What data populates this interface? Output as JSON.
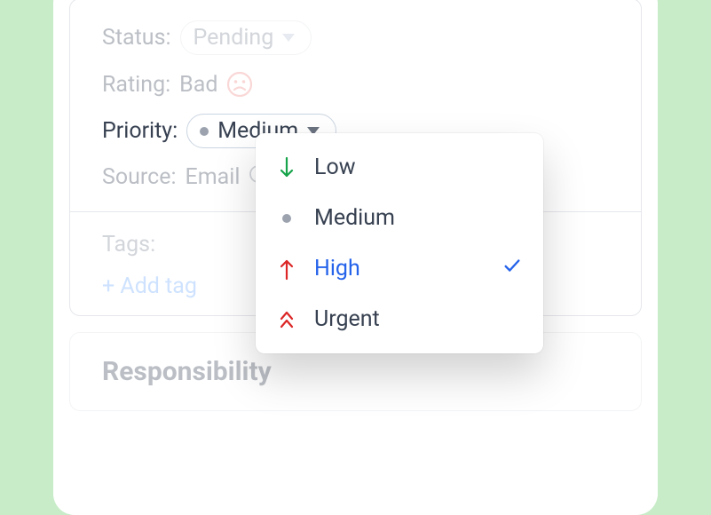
{
  "fields": {
    "status": {
      "label": "Status:",
      "value": "Pending"
    },
    "rating": {
      "label": "Rating:",
      "value": "Bad"
    },
    "priority": {
      "label": "Priority:",
      "value": "Medium"
    },
    "source": {
      "label": "Source:",
      "value": "Email"
    }
  },
  "tags": {
    "label": "Tags:",
    "add_link": "+ Add tag"
  },
  "section": {
    "heading": "Responsibility"
  },
  "priority_menu": {
    "options": [
      {
        "label": "Low"
      },
      {
        "label": "Medium"
      },
      {
        "label": "High"
      },
      {
        "label": "Urgent"
      }
    ],
    "selected": "High"
  },
  "colors": {
    "green": "#16a34a",
    "red": "#dc2626",
    "blue": "#2563eb",
    "grey": "#9ca3af",
    "rose": "#f4a8a8"
  }
}
